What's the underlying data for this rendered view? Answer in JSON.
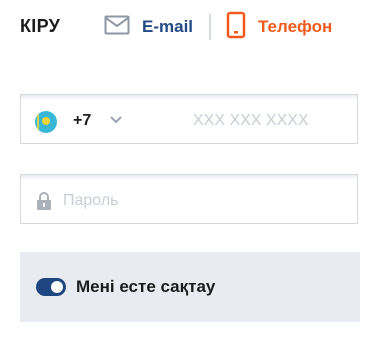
{
  "header": {
    "title": "КІРУ",
    "tabs": [
      {
        "label": "E-mail",
        "icon": "envelope-icon",
        "color": "#234a84"
      },
      {
        "label": "Телефон",
        "icon": "phone-icon",
        "color": "#f05a1c",
        "active": true
      }
    ]
  },
  "phone": {
    "country_flag": "kazakhstan-flag-icon",
    "country_code": "+7",
    "placeholder": "XXX XXX XXXX",
    "value": ""
  },
  "password": {
    "placeholder": "Пароль",
    "value": ""
  },
  "remember": {
    "label": "Мені есте сақтау",
    "enabled": true
  },
  "colors": {
    "primary": "#1f4680",
    "accent": "#f05a1c",
    "panel": "#e8ebef"
  }
}
